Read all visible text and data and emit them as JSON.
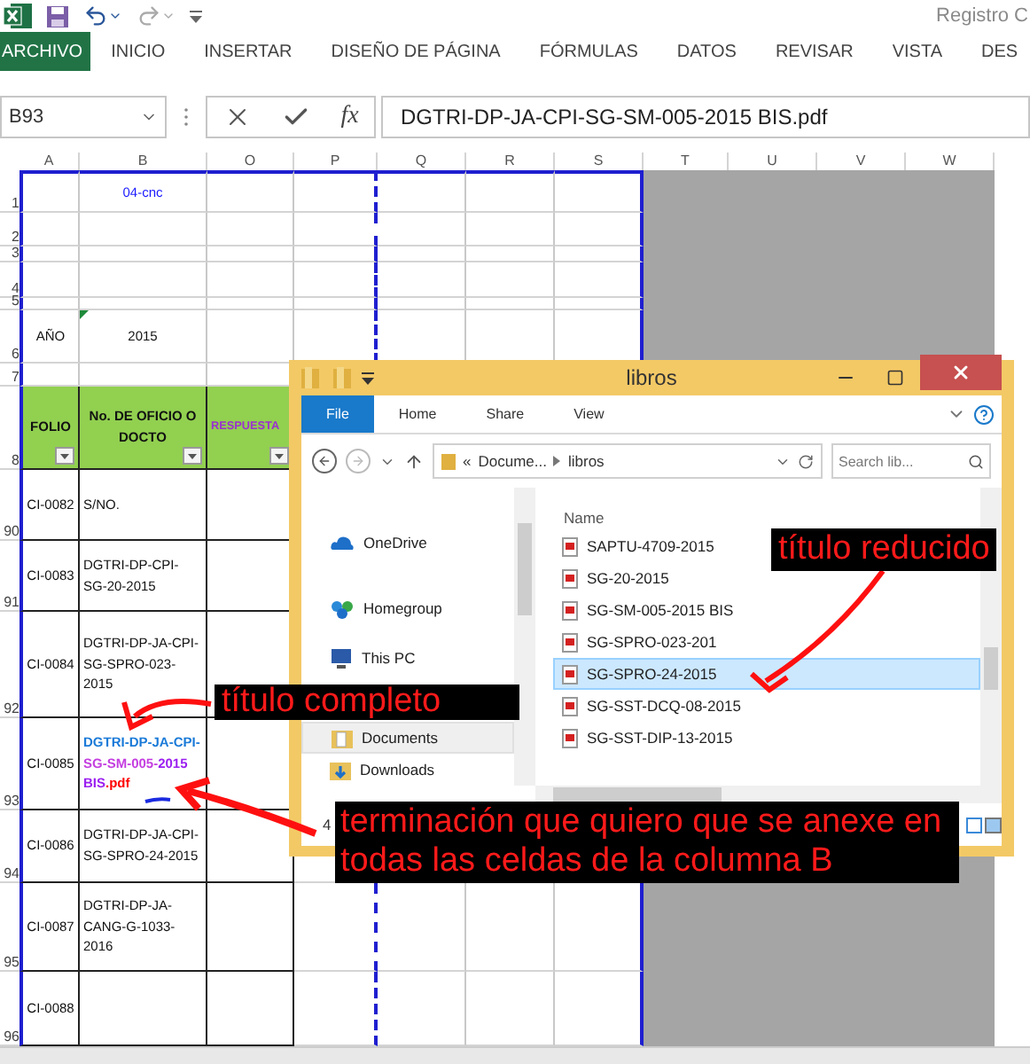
{
  "app_title": "Registro C",
  "ribbon_tabs": [
    {
      "label": "ARCHIVO",
      "kind": "file"
    },
    {
      "label": "INICIO",
      "kind": "tab"
    },
    {
      "label": "INSERTAR",
      "kind": "tab"
    },
    {
      "label": "DISEÑO DE PÁGINA",
      "kind": "tab"
    },
    {
      "label": "FÓRMULAS",
      "kind": "tab"
    },
    {
      "label": "DATOS",
      "kind": "tab"
    },
    {
      "label": "REVISAR",
      "kind": "tab"
    },
    {
      "label": "VISTA",
      "kind": "tab"
    },
    {
      "label": "DES",
      "kind": "tab"
    }
  ],
  "formula_bar": {
    "name_box": "B93",
    "function_label": "fx",
    "value": "DGTRI-DP-JA-CPI-SG-SM-005-2015 BIS.pdf"
  },
  "columns": [
    "A",
    "B",
    "O",
    "P",
    "Q",
    "R",
    "S",
    "T",
    "U",
    "V",
    "W"
  ],
  "rows": [
    {
      "number": "1",
      "kind": "blank",
      "b": "04-cnc"
    },
    {
      "number": "2",
      "kind": "blank"
    },
    {
      "number": "3",
      "kind": "blank"
    },
    {
      "number": "4",
      "kind": "blank"
    },
    {
      "number": "5",
      "kind": "blank"
    },
    {
      "number": "6",
      "kind": "blank",
      "a": "AÑO",
      "b": "2015",
      "b_flag": true
    },
    {
      "number": "7",
      "kind": "blank"
    },
    {
      "number": "8",
      "kind": "header",
      "a": "FOLIO",
      "b": "No. DE OFICIO O DOCTO",
      "o": "RESPUESTA"
    },
    {
      "number": "90",
      "kind": "record",
      "a": "CI-0082",
      "b": "S/NO."
    },
    {
      "number": "91",
      "kind": "record",
      "a": "CI-0083",
      "b": "DGTRI-DP-CPI-SG-20-2015"
    },
    {
      "number": "92",
      "kind": "record",
      "a": "CI-0084",
      "b": "DGTRI-DP-JA-CPI-SG-SPRO-023-2015"
    },
    {
      "number": "93",
      "kind": "record",
      "a": "CI-0085",
      "b_parts": [
        {
          "text": "DGTRI-DP-JA-CPI-",
          "color": "#1a7ad8"
        },
        {
          "text": "SG-SM-005-",
          "color": "#c43ee0"
        },
        {
          "text": "2015 BIS",
          "color": "#9b1ff0"
        },
        {
          "text": ".pdf",
          "color": "#ff0000"
        }
      ]
    },
    {
      "number": "94",
      "kind": "record",
      "a": "CI-0086",
      "b": "DGTRI-DP-JA-CPI-SG-SPRO-24-2015"
    },
    {
      "number": "95",
      "kind": "record",
      "a": "CI-0087",
      "b": "DGTRI-DP-JA-CANG-G-1033-2016"
    },
    {
      "number": "96",
      "kind": "record",
      "a": "CI-0088"
    }
  ],
  "explorer": {
    "title": "libros",
    "tabs": [
      {
        "label": "File",
        "selected": true
      },
      {
        "label": "Home",
        "selected": false
      },
      {
        "label": "Share",
        "selected": false
      },
      {
        "label": "View",
        "selected": false
      }
    ],
    "path_prefix": "«",
    "path": [
      "Docume...",
      "libros"
    ],
    "search": {
      "placeholder": "Search lib..."
    },
    "nav_items": [
      {
        "label": "OneDrive",
        "selected": false
      },
      {
        "label": "Homegroup",
        "selected": false
      },
      {
        "label": "This PC",
        "selected": false
      },
      {
        "label": "Documents",
        "selected": true
      },
      {
        "label": "Downloads",
        "selected": false
      }
    ],
    "column_header": "Name",
    "files": [
      {
        "name": "SAPTU-4709-2015",
        "selected": false
      },
      {
        "name": "SG-20-2015",
        "selected": false
      },
      {
        "name": "SG-SM-005-2015 BIS",
        "selected": false
      },
      {
        "name": "SG-SPRO-023-201",
        "selected": false
      },
      {
        "name": "SG-SPRO-24-2015",
        "selected": true
      },
      {
        "name": "SG-SST-DCQ-08-2015",
        "selected": false
      },
      {
        "name": "SG-SST-DIP-13-2015",
        "selected": false
      }
    ],
    "status": "4"
  },
  "annotations": [
    {
      "text": "título reducido",
      "kind": "top"
    },
    {
      "text": "título completo",
      "kind": "middle"
    },
    {
      "text": "terminación que quiero que se anexe en todas las celdas de la columna B",
      "kind": "bottom"
    }
  ]
}
